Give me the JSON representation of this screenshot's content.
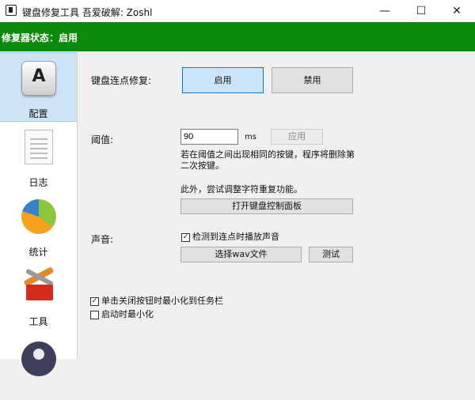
{
  "window": {
    "title": "键盘修复工具 吾爱破解: Zoshl",
    "app_icon": "keyboard-app-icon",
    "controls": {
      "minimize": "—",
      "maximize": "☐",
      "close": "✕"
    }
  },
  "status": {
    "text": "修复器状态：启用",
    "bar_color": "#0b8a0b"
  },
  "sidebar": {
    "items": [
      {
        "label": "配置",
        "icon": "keyboard-key-icon",
        "selected": true
      },
      {
        "label": "日志",
        "icon": "document-icon"
      },
      {
        "label": "统计",
        "icon": "pie-chart-icon"
      },
      {
        "label": "工具",
        "icon": "toolbox-icon"
      },
      {
        "label": "",
        "icon": "user-avatar-icon"
      }
    ],
    "key_glyph": "A"
  },
  "config": {
    "repair_label": "键盘连点修复:",
    "enable_button": "启用",
    "disable_button": "禁用",
    "threshold_label": "阈值:",
    "threshold_value": "90",
    "threshold_unit": "ms",
    "apply_button": "应用",
    "description_line1": "若在阈值之间出现相同的按键，程序将删除第",
    "description_line2": "二次按键。",
    "extra_note": "此外，尝试调整字符重复功能。",
    "open_panel_button": "打开键盘控制面板",
    "sound_label": "声音:",
    "sound_checkbox": "检测到连点时播放声音",
    "sound_checked": true,
    "choose_wav_button": "选择wav文件",
    "test_button": "测试",
    "minimize_on_close": "单击关闭按钮时最小化到任务栏",
    "minimize_on_close_checked": true,
    "start_minimized": "启动时最小化",
    "start_minimized_checked": false
  }
}
